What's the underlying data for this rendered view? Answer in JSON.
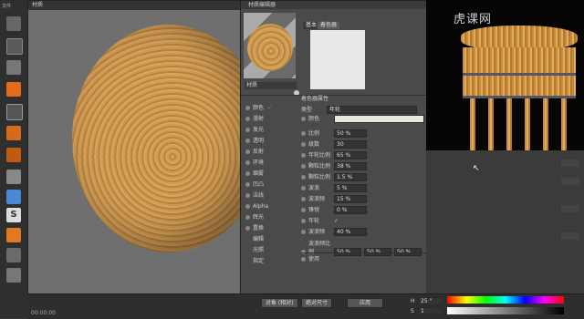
{
  "toolbar": {
    "menu_label": "文件"
  },
  "viewport": {
    "title": "材质"
  },
  "editor": {
    "title": "材质编辑器",
    "tabs": [
      "基本",
      "着色器"
    ],
    "material_name": "材质",
    "channels": [
      {
        "label": "颜色",
        "checked": true
      },
      {
        "label": "漫射",
        "checked": false
      },
      {
        "label": "发光",
        "checked": false
      },
      {
        "label": "透明",
        "checked": false
      },
      {
        "label": "反射",
        "checked": false
      },
      {
        "label": "环境",
        "checked": false
      },
      {
        "label": "烟雾",
        "checked": false
      },
      {
        "label": "凹凸",
        "checked": false
      },
      {
        "label": "法线",
        "checked": false
      },
      {
        "label": "Alpha",
        "checked": false
      },
      {
        "label": "辉光",
        "checked": false
      },
      {
        "label": "置换",
        "checked": false
      },
      {
        "label": "编辑",
        "checked": null
      },
      {
        "label": "光照",
        "checked": null
      },
      {
        "label": "指定",
        "checked": null
      }
    ],
    "section_title": "着色器属性",
    "props": [
      {
        "label": "类型",
        "value": "年轮"
      },
      {
        "label": "颜色",
        "value": ""
      },
      {
        "label": "比例",
        "value": "50 %"
      },
      {
        "label": "级数",
        "value": "30"
      },
      {
        "label": "年轮比例",
        "value": "65 %"
      },
      {
        "label": "颗粒比例",
        "value": "38 %"
      },
      {
        "label": "颗粒比例",
        "value": "1.5 %"
      },
      {
        "label": "波浪",
        "value": "5 %"
      },
      {
        "label": "波浪频",
        "value": "15 %"
      },
      {
        "label": "锋锐",
        "value": "0 %"
      },
      {
        "label": "年轮",
        "value": "✓"
      },
      {
        "label": "波浪频",
        "value": "40 %"
      },
      {
        "label": "波浪频比例",
        "value": "50 %"
      }
    ],
    "scale_extra": [
      "50 %",
      "50 %"
    ],
    "footer_label": "使用"
  },
  "bottom": {
    "time": "00:00:00",
    "dropdown1": "对象 (相对)",
    "dropdown2": "绝对尺寸",
    "apply": "应用",
    "h_label": "H",
    "s_label": "S",
    "h_value": "25 °",
    "s_value": "1"
  },
  "watermark": "虎课网"
}
